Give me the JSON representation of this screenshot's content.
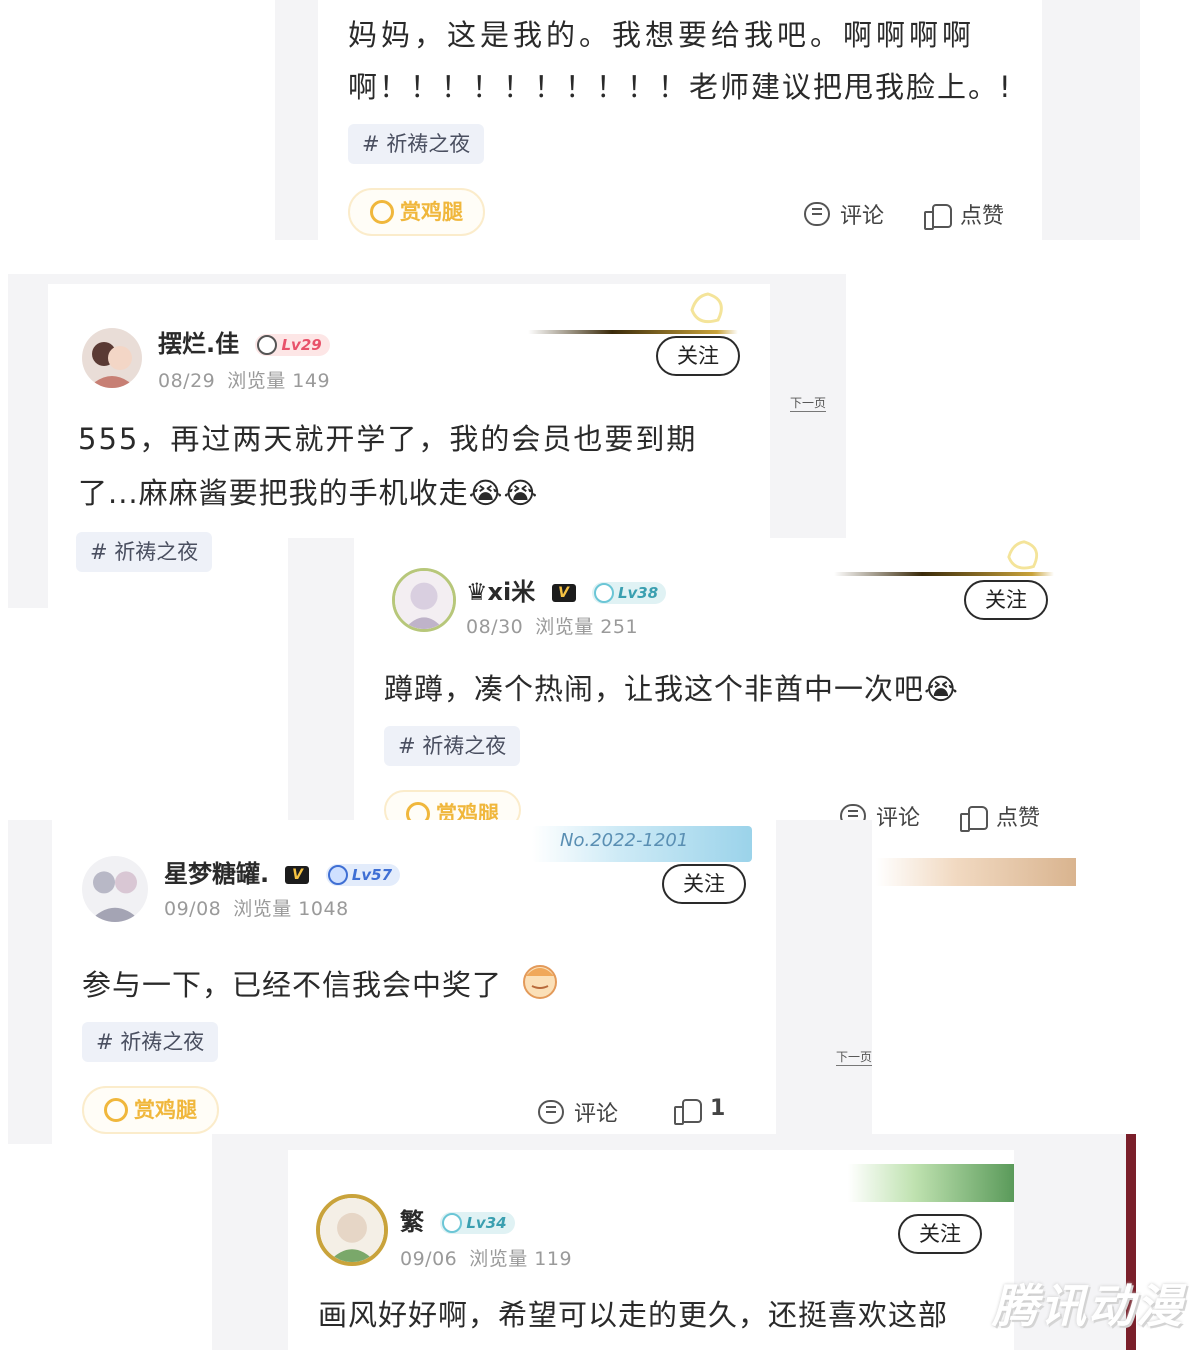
{
  "posts": [
    {
      "text_line1": "妈妈，这是我的。我想要给我吧。啊啊啊啊",
      "text_line2": "啊！！！！！！！！！！老师建议把甩我脸上。!",
      "tag": "# 祈祷之夜",
      "reward": "赏鸡腿",
      "comment": "评论",
      "like": "点赞"
    },
    {
      "username": "摆烂.佳",
      "level": "Lv29",
      "date": "08/29",
      "views": "浏览量 149",
      "follow": "关注",
      "text_line1": "555，再过两天就开学了，我的会员也要到期",
      "text_line2": "了...麻麻酱要把我的手机收走😭😭",
      "tag": "# 祈祷之夜",
      "next": "下一页"
    },
    {
      "username": "♛xi米",
      "vip": "V",
      "level": "Lv38",
      "date": "08/30",
      "views": "浏览量 251",
      "follow": "关注",
      "text_line1": "蹲蹲，凑个热闹，让我这个非酋中一次吧😭",
      "tag": "# 祈祷之夜",
      "reward": "赏鸡腿",
      "comment": "评论",
      "like": "点赞"
    },
    {
      "username": "星梦糖罐.",
      "vip": "V",
      "level": "Lv57",
      "date": "09/08",
      "views": "浏览量 1048",
      "follow": "关注",
      "badge_no": "No.2022-1201",
      "text_line1": "参与一下，已经不信我会中奖了",
      "tag": "# 祈祷之夜",
      "reward": "赏鸡腿",
      "comment": "评论",
      "like": "1",
      "next": "下一页"
    },
    {
      "username": "繁",
      "level": "Lv34",
      "date": "09/06",
      "views": "浏览量 119",
      "follow": "关注",
      "text_line1": "画风好好啊，希望可以走的更久，还挺喜欢这部"
    }
  ],
  "watermark": "腾讯动漫",
  "colors": {
    "accent_gold": "#f0b73c",
    "tag_bg": "#eef1f8",
    "lv_red": "#e8526a",
    "lv_teal": "#3a9fb0",
    "lv_blue": "#3f6fd4"
  },
  "icons": [
    "comment-icon",
    "like-icon",
    "reward-icon",
    "vip-icon",
    "level-icon"
  ]
}
